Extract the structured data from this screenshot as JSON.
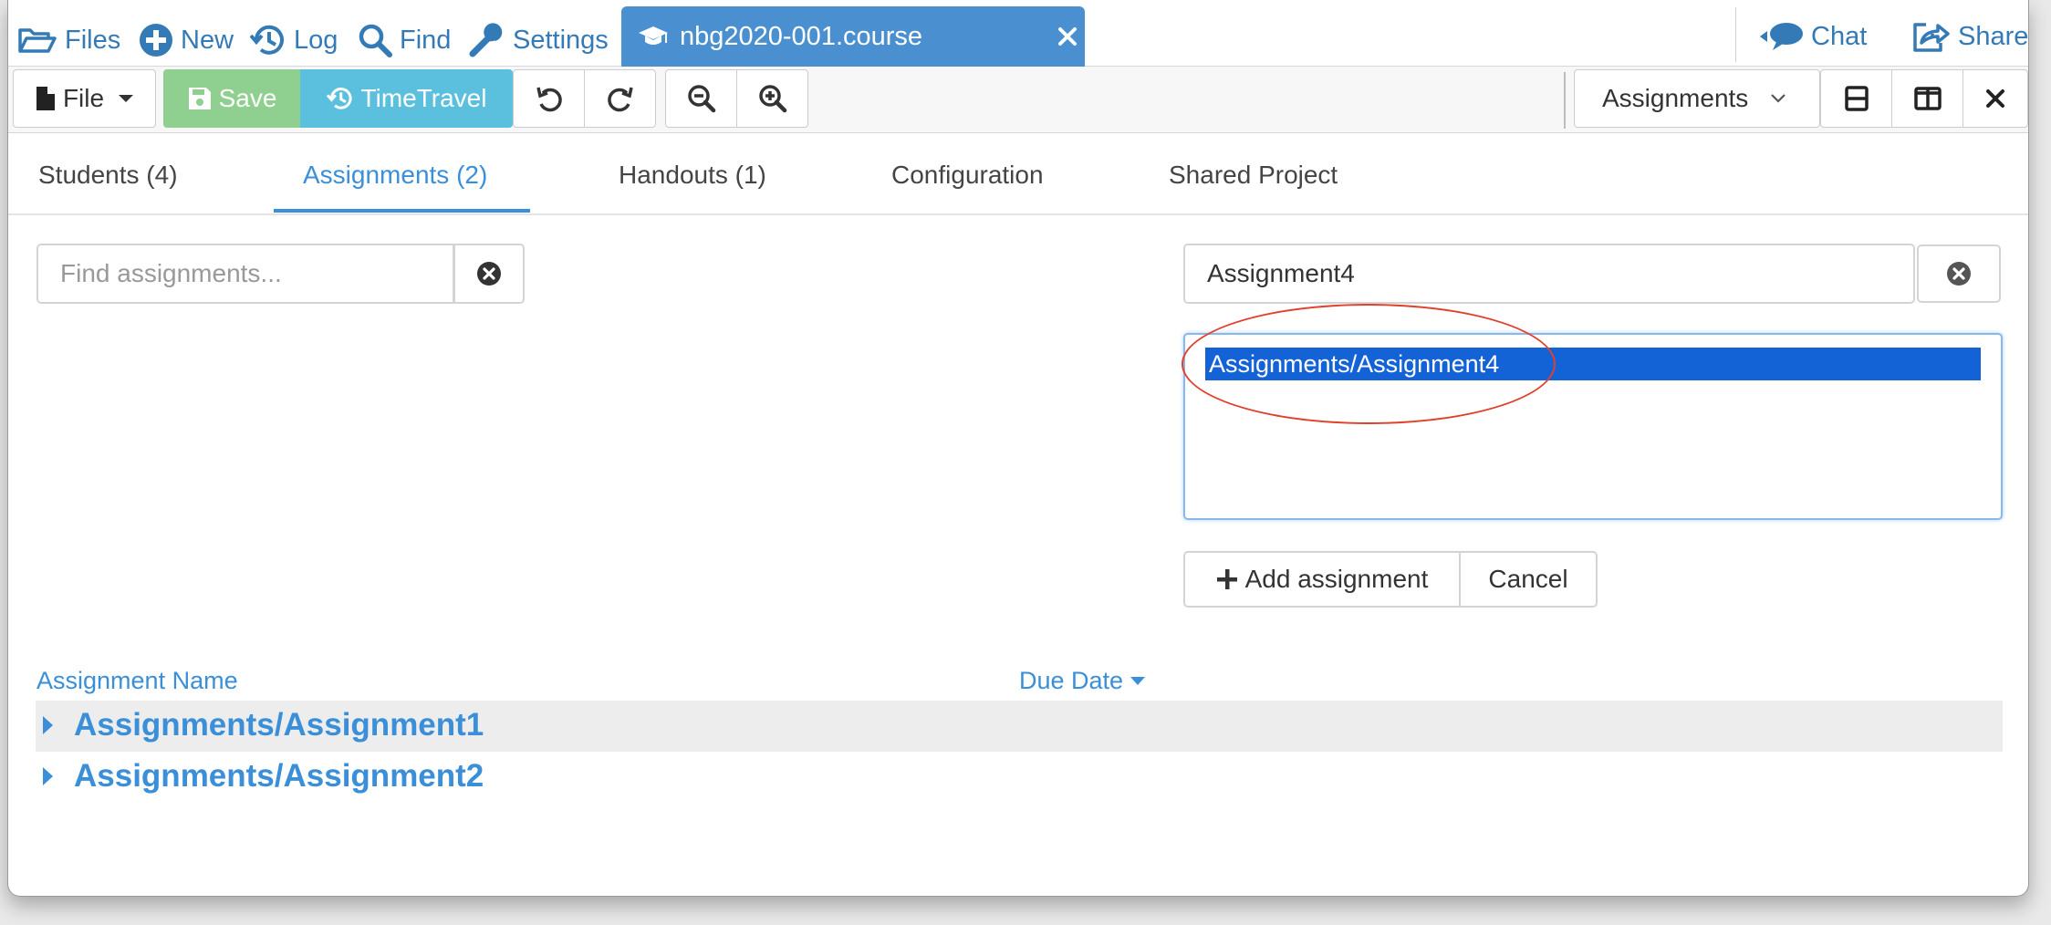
{
  "nav": {
    "files": "Files",
    "new": "New",
    "log": "Log",
    "find": "Find",
    "settings": "Settings",
    "chat": "Chat",
    "share": "Share"
  },
  "file_tab": {
    "label": "nbg2020-001.course"
  },
  "toolbar": {
    "file_label": "File",
    "save_label": "Save",
    "timetravel_label": "TimeTravel",
    "view_select": "Assignments"
  },
  "tabs": [
    {
      "label": "Students (4)"
    },
    {
      "label": "Assignments (2)",
      "active": true
    },
    {
      "label": "Handouts (1)"
    },
    {
      "label": "Configuration"
    },
    {
      "label": "Shared Project"
    }
  ],
  "search": {
    "placeholder": "Find assignments...",
    "value": ""
  },
  "add_panel": {
    "name_value": "Assignment4",
    "options": [
      "Assignments/Assignment4"
    ],
    "add_label": "Add assignment",
    "cancel_label": "Cancel"
  },
  "table": {
    "col_name": "Assignment Name",
    "col_due": "Due Date",
    "rows": [
      {
        "name": "Assignments/Assignment1"
      },
      {
        "name": "Assignments/Assignment2"
      }
    ]
  },
  "colors": {
    "accent": "#337ab7",
    "tab_active": "#3a8fd8",
    "file_tab_bg": "#4a90d0",
    "save_green": "#8fcf8f",
    "timetravel_cyan": "#5bc0de",
    "selection_blue": "#1463d6",
    "annotation_red": "#e0402c"
  },
  "icons": {
    "files": "folder-open-icon",
    "new": "plus-circle-icon",
    "log": "history-icon",
    "find": "search-icon",
    "settings": "wrench-icon",
    "file_tab": "graduation-cap-icon",
    "chat": "chat-bubble-icon",
    "share": "share-icon"
  }
}
